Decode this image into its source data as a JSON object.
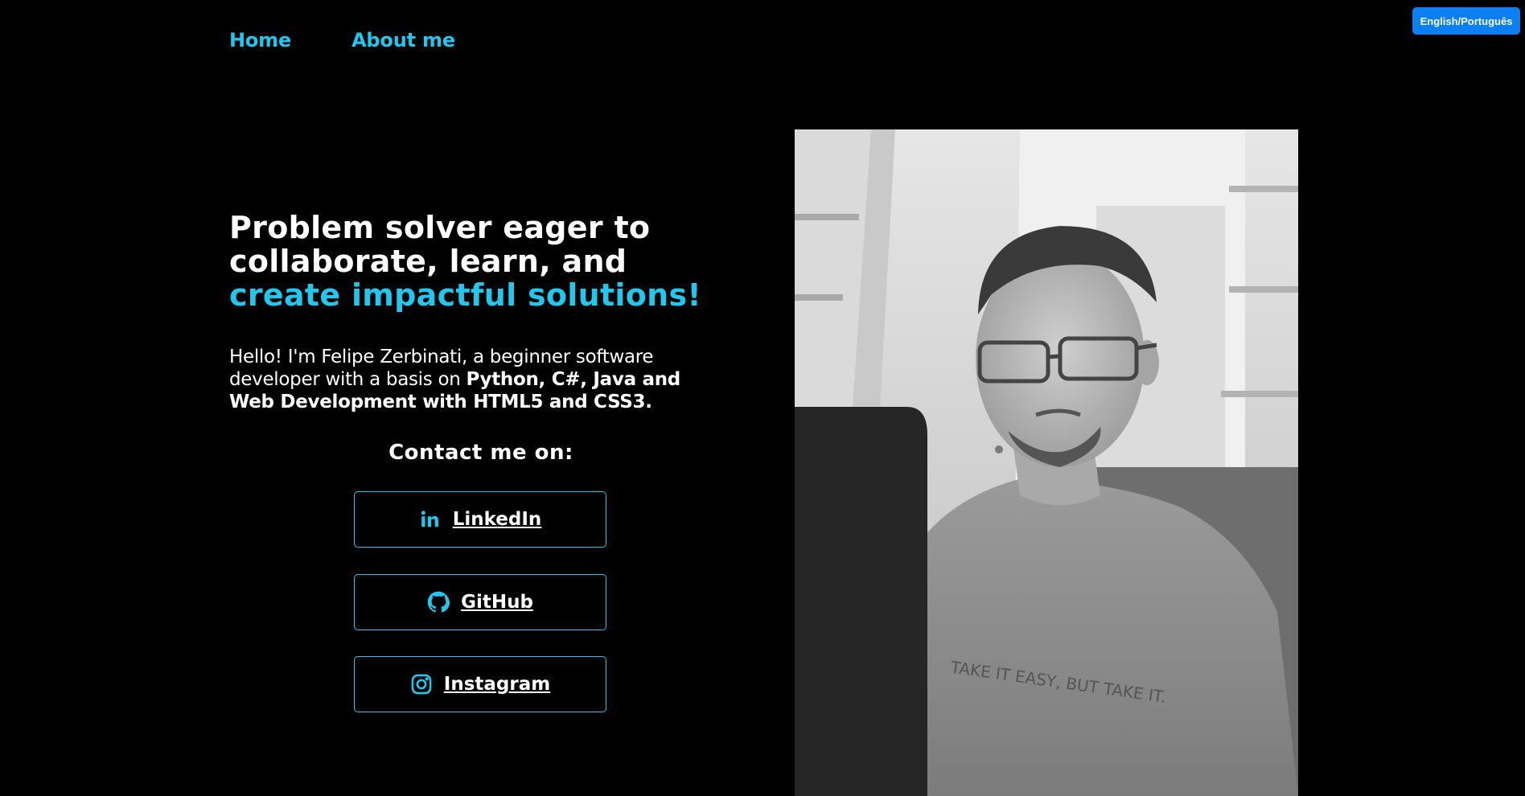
{
  "nav": {
    "home": "Home",
    "about": "About me"
  },
  "language_toggle": "English/Português",
  "hero": {
    "headline_line1": "Problem solver eager to",
    "headline_line2": "collaborate, learn, and",
    "headline_accent": "create impactful solutions!",
    "intro_plain": "Hello! I'm Felipe Zerbinati, a beginner software developer with a basis on",
    "intro_bold": "Python, C#, Java and Web Development with HTML5 and CSS3."
  },
  "contact": {
    "title": "Contact me on:",
    "linkedin": "LinkedIn",
    "github": "GitHub",
    "instagram": "Instagram"
  },
  "photo": {
    "shirt_text": "TAKE IT EASY, BUT TAKE IT."
  },
  "colors": {
    "accent": "#22c7ee",
    "background": "#000000",
    "button_blue": "#0d7ff5"
  }
}
